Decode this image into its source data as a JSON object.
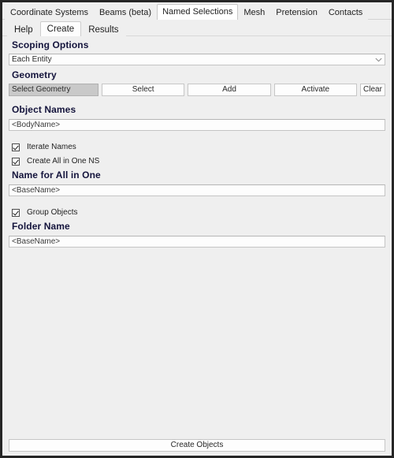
{
  "window": {
    "frame_color": "#262626",
    "background": "#efefef"
  },
  "primary_tabs": {
    "active": "Named Selections",
    "items": [
      {
        "label": "Coordinate Systems",
        "active": false
      },
      {
        "label": "Beams (beta)",
        "active": false
      },
      {
        "label": "Named Selections",
        "active": true
      },
      {
        "label": "Mesh",
        "active": false
      },
      {
        "label": "Pretension",
        "active": false
      },
      {
        "label": "Contacts",
        "active": false
      }
    ]
  },
  "secondary_tabs": {
    "active": "Create",
    "items": [
      {
        "label": "Help",
        "active": false
      },
      {
        "label": "Create",
        "active": true
      },
      {
        "label": "Results",
        "active": false
      }
    ]
  },
  "sections": {
    "scoping_options": {
      "heading": "Scoping Options",
      "dropdown": {
        "selected": "Each Entity",
        "options": [
          "Each Entity"
        ],
        "arrow_icon": "chevron-down-icon"
      }
    },
    "geometry": {
      "heading": "Geometry",
      "selection_display": "Select Geometry",
      "buttons": {
        "select": "Select",
        "add": "Add",
        "activate": "Activate",
        "clear": "Clear"
      }
    },
    "object_names": {
      "heading": "Object Names",
      "input_value": "<BodyName>",
      "checkboxes": [
        {
          "label": "Iterate Names",
          "checked": true
        },
        {
          "label": "Create All in One NS",
          "checked": true
        }
      ]
    },
    "name_for_all_in_one": {
      "heading": "Name for All in One",
      "input_value": "<BaseName>"
    },
    "group_objects": {
      "label": "Group Objects",
      "checked": true
    },
    "folder_name": {
      "heading": "Folder Name",
      "input_value": "<BaseName>"
    }
  },
  "bottom_bar": {
    "create_objects_label": "Create Objects"
  },
  "colors": {
    "heading": "#14143c",
    "panel_bg": "#efefef",
    "field_bg": "#fdfdfd",
    "disabled_field_bg": "#c9c9c9",
    "border": "#c6c6c6"
  }
}
